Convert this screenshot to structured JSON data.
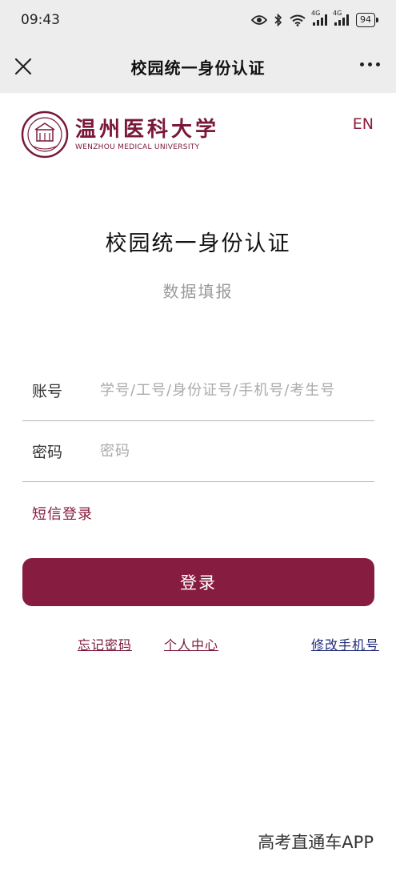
{
  "status_bar": {
    "time": "09:43",
    "signal_1_net": "4G",
    "signal_2_net": "4G",
    "battery": "94"
  },
  "nav": {
    "title": "校园统一身份认证"
  },
  "brand": {
    "name_cn": "温州医科大学",
    "name_en": "WENZHOU MEDICAL UNIVERSITY",
    "color": "#7a1838"
  },
  "lang_toggle": "EN",
  "page": {
    "title": "校园统一身份认证",
    "subtitle": "数据填报"
  },
  "form": {
    "account_label": "账号",
    "account_placeholder": "学号/工号/身份证号/手机号/考生号",
    "account_value": "",
    "password_label": "密码",
    "password_placeholder": "密码",
    "password_value": ""
  },
  "sms_login": "短信登录",
  "login_button": "登录",
  "links": {
    "forgot_password": "忘记密码",
    "personal_center": "个人中心",
    "change_phone": "修改手机号"
  },
  "watermark": "高考直通车APP",
  "colors": {
    "primary": "#861d40",
    "link_blue": "#1f2a7a",
    "header_bg": "#ededed"
  }
}
